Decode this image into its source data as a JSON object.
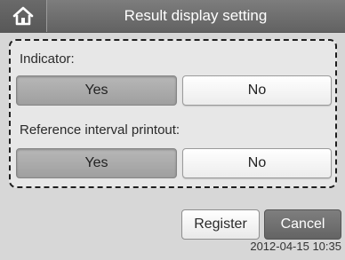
{
  "header": {
    "home_icon": "home-icon",
    "title": "Result display setting"
  },
  "settings": {
    "indicator": {
      "label": "Indicator:",
      "options": [
        "Yes",
        "No"
      ],
      "selected": "Yes"
    },
    "reference_interval_printout": {
      "label": "Reference interval printout:",
      "options": [
        "Yes",
        "No"
      ],
      "selected": "Yes"
    }
  },
  "footer": {
    "register_label": "Register",
    "cancel_label": "Cancel",
    "datetime": "2012-04-15 10:35"
  }
}
